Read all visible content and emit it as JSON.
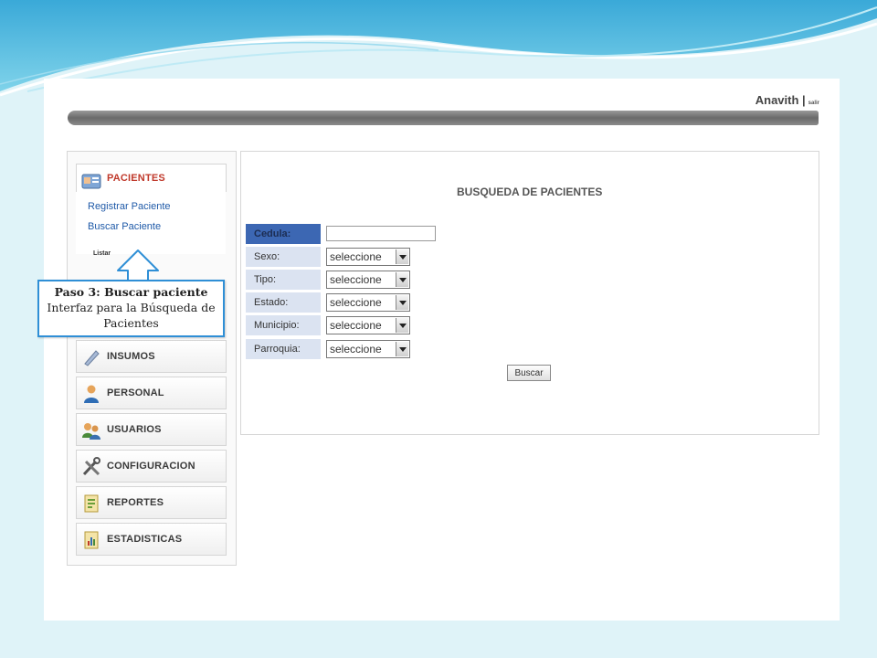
{
  "header": {
    "user": "Anavith |",
    "logout": "salir"
  },
  "sidebar": {
    "active": {
      "label": "PACIENTES",
      "icon": "patients-icon"
    },
    "submenu": [
      {
        "label": "Registrar Paciente"
      },
      {
        "label": "Buscar Paciente"
      }
    ],
    "partial_item": "Listar",
    "items": [
      {
        "label": "INSUMOS",
        "icon": "pen-icon"
      },
      {
        "label": "PERSONAL",
        "icon": "person-icon"
      },
      {
        "label": "USUARIOS",
        "icon": "users-icon"
      },
      {
        "label": "CONFIGURACION",
        "icon": "tools-icon"
      },
      {
        "label": "REPORTES",
        "icon": "report-icon"
      },
      {
        "label": "ESTADISTICAS",
        "icon": "stats-icon"
      }
    ]
  },
  "main": {
    "title": "BUSQUEDA DE PACIENTES",
    "fields": [
      {
        "label": "Cedula:",
        "type": "text",
        "value": ""
      },
      {
        "label": "Sexo:",
        "type": "select",
        "value": "seleccione"
      },
      {
        "label": "Tipo:",
        "type": "select",
        "value": "seleccione"
      },
      {
        "label": "Estado:",
        "type": "select",
        "value": "seleccione"
      },
      {
        "label": "Municipio:",
        "type": "select",
        "value": "seleccione"
      },
      {
        "label": "Parroquia:",
        "type": "select",
        "value": "seleccione"
      }
    ],
    "search_button": "Buscar"
  },
  "callout": {
    "title": "Paso 3: Buscar paciente",
    "text": "Interfaz para la Búsqueda de Pacientes"
  },
  "colors": {
    "accent_blue": "#3c67b3",
    "label_bg": "#dbe3f1",
    "active_menu": "#c0392b",
    "callout_border": "#2f8fd6"
  }
}
